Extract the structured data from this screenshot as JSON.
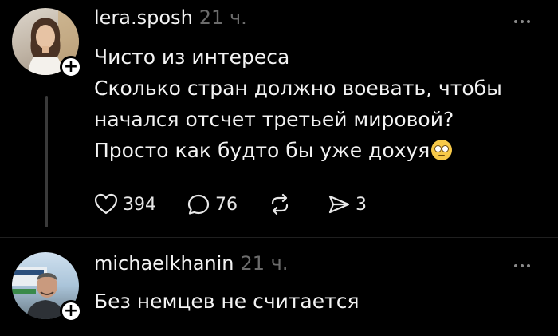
{
  "posts": [
    {
      "username": "lera.sposh",
      "timestamp": "21 ч.",
      "text": "Чисто из интереса\nСколько стран должно воевать, чтобы\nначался отсчет третьей мировой?\nПросто как будто бы уже дохуя",
      "emoji": "face-with-rolling-eyes",
      "actions": {
        "likes": "394",
        "comments": "76",
        "reposts": "",
        "shares": "3"
      }
    },
    {
      "username": "michaelkhanin",
      "timestamp": "21 ч.",
      "text": "Без немцев не считается"
    }
  ],
  "icons": {
    "like": "heart-icon",
    "comment": "speech-bubble-icon",
    "repost": "repost-icon",
    "share": "send-icon",
    "follow": "plus-icon",
    "more": "more-icon"
  },
  "colors": {
    "background": "#000000",
    "text": "#f3f3f3",
    "muted": "#6b6b6b",
    "thread_line": "#3a3a3a"
  }
}
